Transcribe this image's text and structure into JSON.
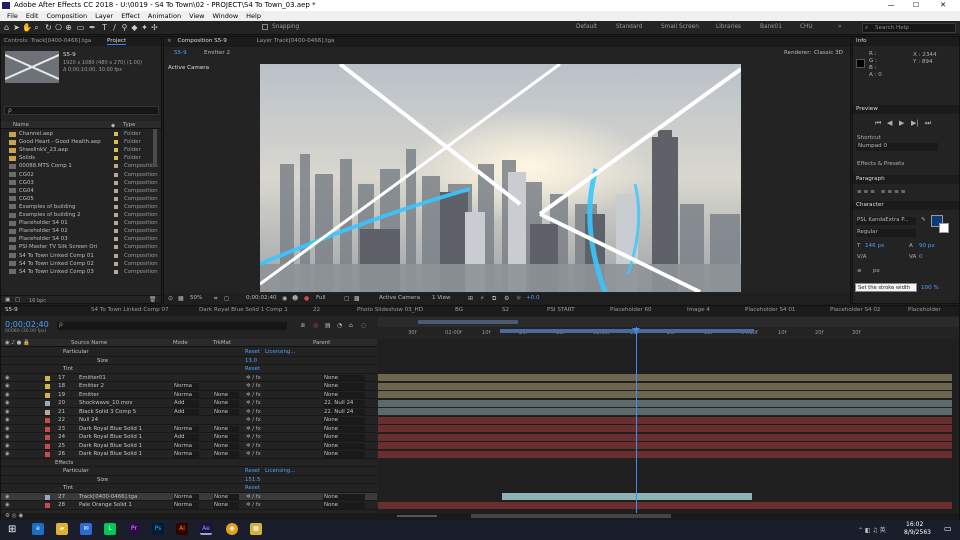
{
  "window": {
    "title": "Adobe After Effects CC 2018 - U:\\0019 - S4 To Town\\02 - PROJECT\\S4 To Town_03.aep *",
    "minimize": "—",
    "maximize": "☐",
    "close": "✕"
  },
  "menu": [
    "File",
    "Edit",
    "Composition",
    "Layer",
    "Effect",
    "Animation",
    "View",
    "Window",
    "Help"
  ],
  "toolbar": {
    "snapping": "Snapping",
    "workspaces": [
      "Default",
      "Standard",
      "Small Screen",
      "Libraries",
      "Bank01",
      "CHU"
    ],
    "search_placeholder": "Search Help"
  },
  "left_panel": {
    "tabs": [
      "Controls: Track[0400-0466].tga",
      "Project"
    ],
    "thumb_name": "S5-9",
    "thumb_info_1": "1920 x 1080 (480 x 270) (1.00)",
    "thumb_info_2": "Δ 0;00;10;00, 30.00 fps",
    "search_placeholder": "ρ",
    "col_name": "Name",
    "col_type": "Type",
    "items": [
      {
        "name": "Channel.aep",
        "type": "Folder",
        "folder": true,
        "color": "#d6c24a"
      },
      {
        "name": "Good Heart - Good Health.aep",
        "type": "Folder",
        "folder": true,
        "color": "#d6c24a"
      },
      {
        "name": "ShwelinkV_23.aep",
        "type": "Folder",
        "folder": true,
        "color": "#d6c24a"
      },
      {
        "name": "Solids",
        "type": "Folder",
        "folder": true,
        "color": "#d6c24a"
      },
      {
        "name": "00088.MTS Comp 1",
        "type": "Composition",
        "folder": false,
        "color": "#b8a894"
      },
      {
        "name": "CG02",
        "type": "Composition",
        "folder": false,
        "color": "#b8a894"
      },
      {
        "name": "CG03",
        "type": "Composition",
        "folder": false,
        "color": "#b8a894"
      },
      {
        "name": "CG04",
        "type": "Composition",
        "folder": false,
        "color": "#b8a894"
      },
      {
        "name": "CG05",
        "type": "Composition",
        "folder": false,
        "color": "#b8a894"
      },
      {
        "name": "Examples of building",
        "type": "Composition",
        "folder": false,
        "color": "#b8a894"
      },
      {
        "name": "Examples of building 2",
        "type": "Composition",
        "folder": false,
        "color": "#b8a894"
      },
      {
        "name": "Placeholder S4 01",
        "type": "Composition",
        "folder": false,
        "color": "#b8a894"
      },
      {
        "name": "Placeholder S4 02",
        "type": "Composition",
        "folder": false,
        "color": "#b8a894"
      },
      {
        "name": "Placeholder S4 03",
        "type": "Composition",
        "folder": false,
        "color": "#b8a894"
      },
      {
        "name": "PSI Master TV Silk Screen Ori",
        "type": "Composition",
        "folder": false,
        "color": "#b8a894"
      },
      {
        "name": "S4 To Town Linked Comp 01",
        "type": "Composition",
        "folder": false,
        "color": "#b8a894"
      },
      {
        "name": "S4 To Town Linked Comp 02",
        "type": "Composition",
        "folder": false,
        "color": "#b8a894"
      },
      {
        "name": "S4 To Town Linked Comp 03",
        "type": "Composition",
        "folder": false,
        "color": "#b8a894"
      }
    ],
    "bpc": "16 bpc"
  },
  "comp_panel": {
    "tab_comp": "Composition S5-9",
    "tab_layer": "Layer Track[0400-0466].tga",
    "crumbs": [
      "S5-9",
      "Emitter 2"
    ],
    "renderer_label": "Renderer:",
    "renderer_value": "Classic 3D",
    "camera_label": "Active Camera",
    "zoom": "50%",
    "timecode": "0;00;02;40",
    "resolution": "Full",
    "camera_select": "Active Camera",
    "views": "1 View",
    "exposure": "+0.0"
  },
  "right_panel": {
    "info_title": "Info",
    "info_lines": [
      "R :",
      "G :",
      "B :",
      "A : 0"
    ],
    "info_xy": [
      "X : 2344",
      "Y : 894"
    ],
    "preview_title": "Preview",
    "shortcut_label": "Shortcut",
    "shortcut_value": "Numpad 0",
    "effects_presets": "Effects & Presets",
    "paragraph_title": "Paragraph",
    "character_title": "Character",
    "font_name": "PSL KandaExtra P...",
    "font_style": "Regular",
    "font_size": "146 px",
    "leading": "90 px",
    "kerning": "",
    "tracking": "0",
    "stroke_unit": "px",
    "tooltip": "Set the stroke width",
    "scale_pct": "100 %"
  },
  "timeline": {
    "current_time": "0;00;02;40",
    "fps_line": "00080 (30.00 fps)",
    "tabs": [
      "S5-9",
      "S4 To Town Linked Comp 07",
      "Dark Royal Blue Solid 1 Comp 1",
      "22",
      "Photo Slideshow 03_HD",
      "BG",
      "S2",
      "PSI START",
      "Placeholder 60",
      "Image 4",
      "Placeholder S4 01",
      "Placeholder S4 02",
      "Placeholder"
    ],
    "col_source": "Source Name",
    "col_mode": "Mode",
    "col_trkmat": "TrkMat",
    "col_parent": "Parent",
    "ruler": [
      "30f",
      "02:00f",
      "10f",
      "20f",
      "30f",
      "03:00f",
      "10f",
      "20f",
      "30f",
      "04:00f",
      "10f",
      "20f",
      "30f"
    ],
    "props": [
      {
        "label": "Particular",
        "reset": "Reset",
        "extra": "Licensing..."
      },
      {
        "label": "Size",
        "value": "13.0"
      },
      {
        "label": "Tint",
        "reset": "Reset"
      }
    ],
    "layers": [
      {
        "num": "17",
        "name": "Emitter01",
        "mode": "",
        "trk": "",
        "parent": "None",
        "color": "#d6b24a"
      },
      {
        "num": "18",
        "name": "Emitter 2",
        "mode": "Norma",
        "trk": "",
        "parent": "None",
        "color": "#d6b24a"
      },
      {
        "num": "19",
        "name": "Emitter",
        "mode": "Norma",
        "trk": "None",
        "parent": "None",
        "color": "#d6b24a"
      },
      {
        "num": "20",
        "name": "Shockwave_10.mov",
        "mode": "Add",
        "trk": "None",
        "parent": "22. Null 24",
        "color": "#9aa6c2"
      },
      {
        "num": "21",
        "name": "Black Solid 3 Comp 5",
        "mode": "Add",
        "trk": "None",
        "parent": "22. Null 24",
        "color": "#b8a894"
      },
      {
        "num": "22",
        "name": "Null 24",
        "mode": "",
        "trk": "",
        "parent": "None",
        "color": "#c84a4a"
      },
      {
        "num": "23",
        "name": "Dark Royal Blue Solid 1",
        "mode": "Norma",
        "trk": "None",
        "parent": "None",
        "color": "#c84a4a"
      },
      {
        "num": "24",
        "name": "Dark Royal Blue Solid 1",
        "mode": "Add",
        "trk": "None",
        "parent": "None",
        "color": "#c84a4a"
      },
      {
        "num": "25",
        "name": "Dark Royal Blue Solid 1",
        "mode": "Norma",
        "trk": "None",
        "parent": "None",
        "color": "#c84a4a"
      },
      {
        "num": "26",
        "name": "Dark Royal Blue Solid 1",
        "mode": "Norma",
        "trk": "None",
        "parent": "None",
        "color": "#c84a4a"
      }
    ],
    "effects_label": "Effects",
    "props2": [
      {
        "label": "Particular",
        "reset": "Reset",
        "extra": "Licensing..."
      },
      {
        "label": "Size",
        "value": "151.5"
      },
      {
        "label": "Tint",
        "reset": "Reset"
      }
    ],
    "layers2": [
      {
        "num": "27",
        "name": "Track[0400-0466].tga",
        "mode": "Norma",
        "trk": "None",
        "parent": "None",
        "color": "#9aa6c2"
      },
      {
        "num": "28",
        "name": "Pale Orange Solid 1",
        "mode": "Norma",
        "trk": "None",
        "parent": "None",
        "color": "#c84a4a"
      }
    ],
    "toggle_label": "Toggle Switches / Modes"
  },
  "taskbar": {
    "time": "16:02",
    "date": "8/9/2563"
  }
}
